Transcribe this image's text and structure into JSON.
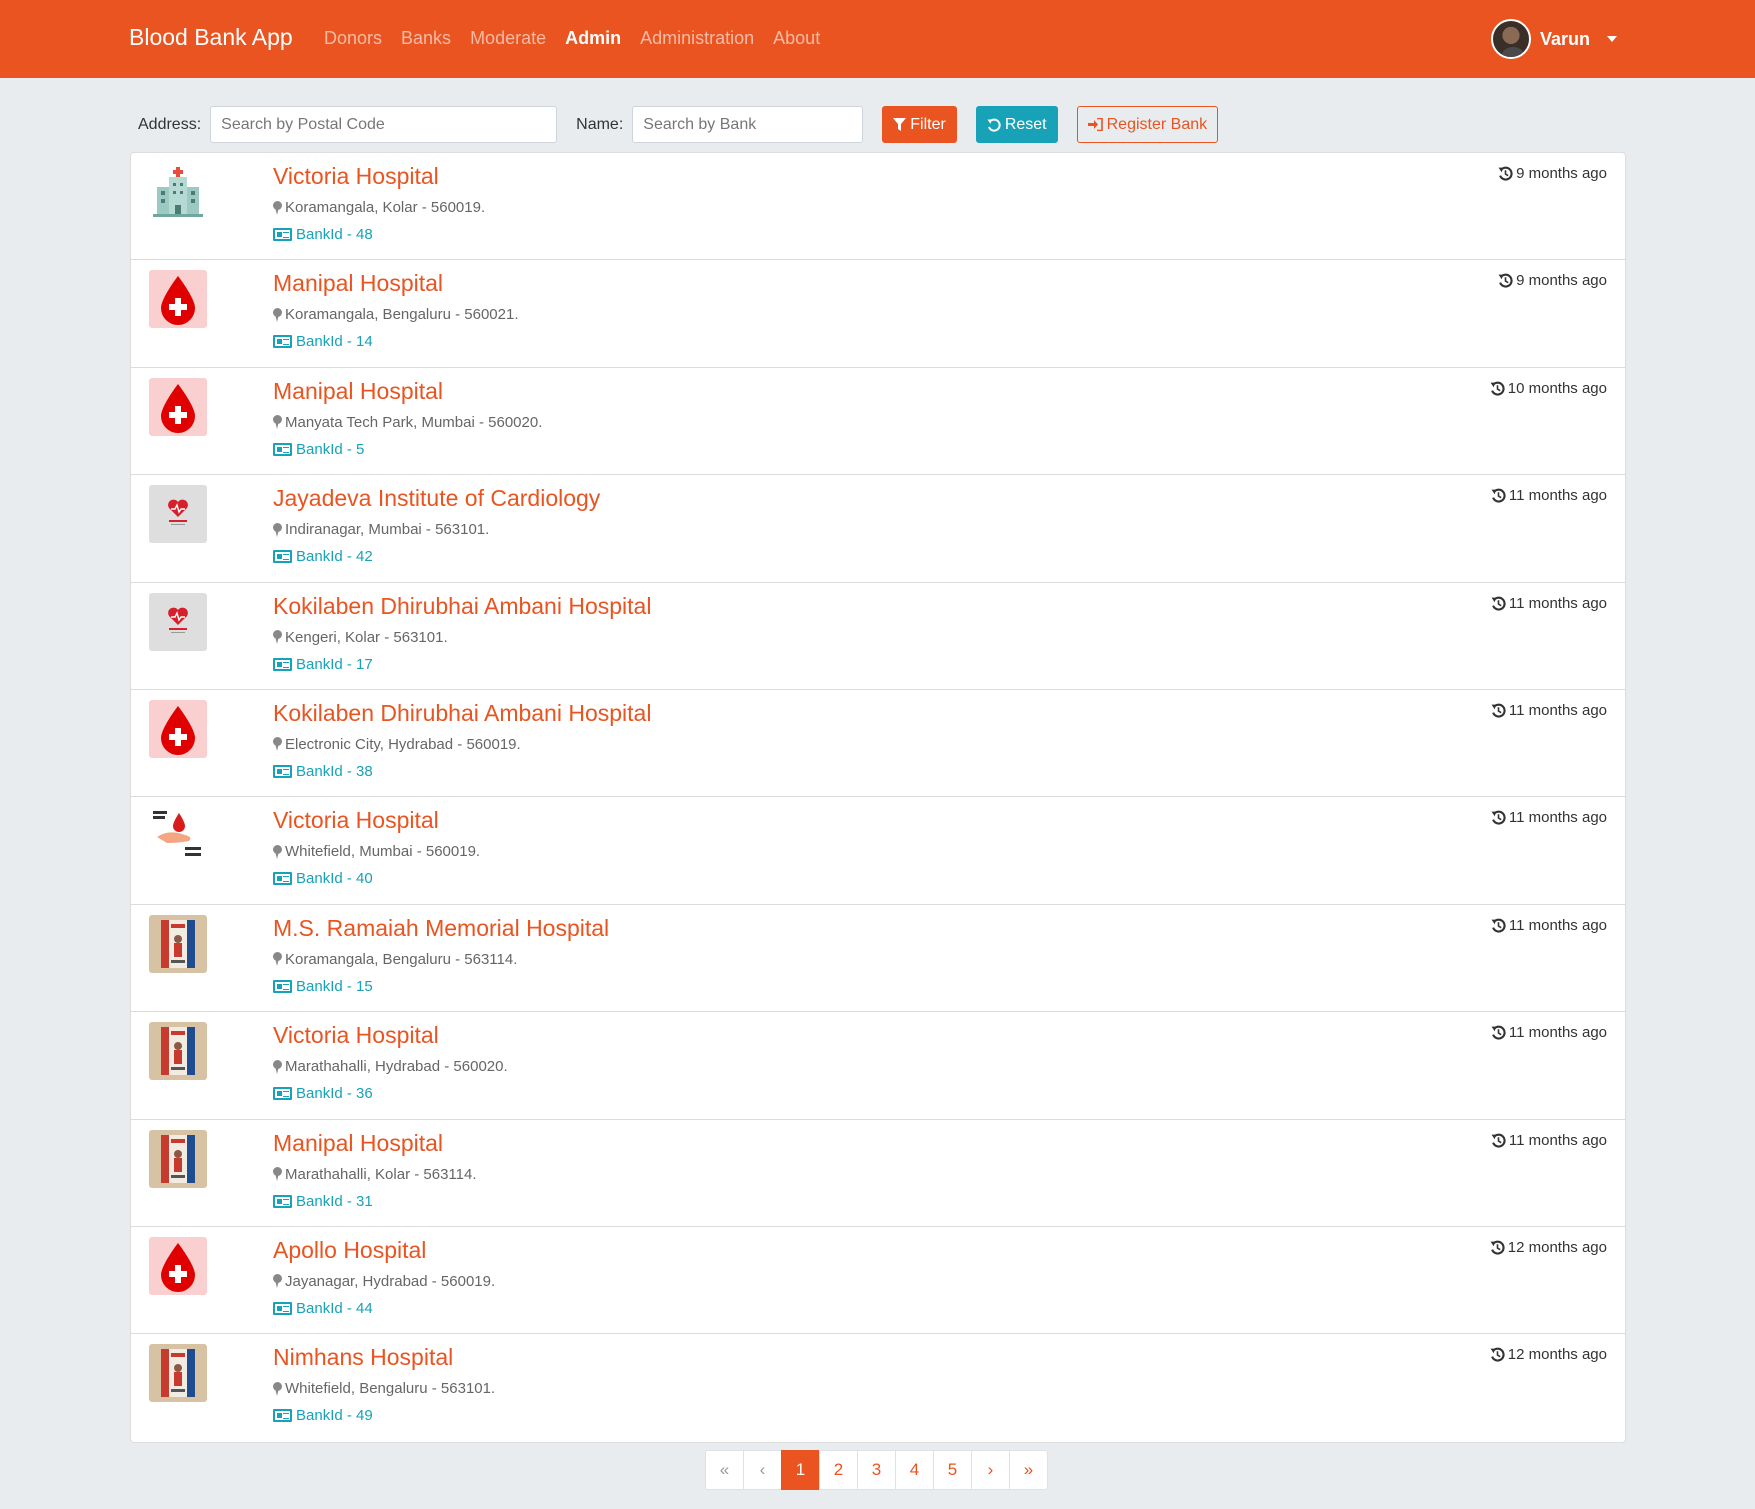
{
  "app": {
    "brand": "Blood Bank App",
    "accent": "#e95420",
    "info": "#17a2b8"
  },
  "nav": {
    "items": [
      {
        "label": "Donors",
        "active": false
      },
      {
        "label": "Banks",
        "active": false
      },
      {
        "label": "Moderate",
        "active": false
      },
      {
        "label": "Admin",
        "active": true
      },
      {
        "label": "Administration",
        "active": false
      },
      {
        "label": "About",
        "active": false
      }
    ],
    "user": {
      "name": "Varun"
    }
  },
  "filters": {
    "address_label": "Address:",
    "address_placeholder": "Search by Postal Code",
    "name_label": "Name:",
    "name_placeholder": "Search by Bank",
    "filter_label": "Filter",
    "reset_label": "Reset",
    "register_label": "Register Bank"
  },
  "banks": [
    {
      "name": "Victoria Hospital",
      "address": "Koramangala, Kolar - 560019.",
      "bank_id": "BankId - 48",
      "time": "9 months ago",
      "thumb": "hospital-building"
    },
    {
      "name": "Manipal Hospital",
      "address": "Koramangala, Bengaluru - 560021.",
      "bank_id": "BankId - 14",
      "time": "9 months ago",
      "thumb": "blood-drop"
    },
    {
      "name": "Manipal Hospital",
      "address": "Manyata Tech Park, Mumbai - 560020.",
      "bank_id": "BankId - 5",
      "time": "10 months ago",
      "thumb": "blood-drop"
    },
    {
      "name": "Jayadeva Institute of Cardiology",
      "address": "Indiranagar, Mumbai - 563101.",
      "bank_id": "BankId - 42",
      "time": "11 months ago",
      "thumb": "heart-logo"
    },
    {
      "name": "Kokilaben Dhirubhai Ambani Hospital",
      "address": "Kengeri, Kolar - 563101.",
      "bank_id": "BankId - 17",
      "time": "11 months ago",
      "thumb": "heart-logo"
    },
    {
      "name": "Kokilaben Dhirubhai Ambani Hospital",
      "address": "Electronic City, Hydrabad - 560019.",
      "bank_id": "BankId - 38",
      "time": "11 months ago",
      "thumb": "blood-drop"
    },
    {
      "name": "Victoria Hospital",
      "address": "Whitefield, Mumbai - 560019.",
      "bank_id": "BankId - 40",
      "time": "11 months ago",
      "thumb": "give-blood-save-life"
    },
    {
      "name": "M.S. Ramaiah Memorial Hospital",
      "address": "Koramangala, Bengaluru - 563114.",
      "bank_id": "BankId - 15",
      "time": "11 months ago",
      "thumb": "poster"
    },
    {
      "name": "Victoria Hospital",
      "address": "Marathahalli, Hydrabad - 560020.",
      "bank_id": "BankId - 36",
      "time": "11 months ago",
      "thumb": "poster"
    },
    {
      "name": "Manipal Hospital",
      "address": "Marathahalli, Kolar - 563114.",
      "bank_id": "BankId - 31",
      "time": "11 months ago",
      "thumb": "poster"
    },
    {
      "name": "Apollo Hospital",
      "address": "Jayanagar, Hydrabad - 560019.",
      "bank_id": "BankId - 44",
      "time": "12 months ago",
      "thumb": "blood-drop"
    },
    {
      "name": "Nimhans Hospital",
      "address": "Whitefield, Bengaluru - 563101.",
      "bank_id": "BankId - 49",
      "time": "12 months ago",
      "thumb": "poster"
    }
  ],
  "pagination": {
    "first": "«",
    "prev": "‹",
    "next": "›",
    "last": "»",
    "pages": [
      "1",
      "2",
      "3",
      "4",
      "5"
    ],
    "current": "1"
  }
}
